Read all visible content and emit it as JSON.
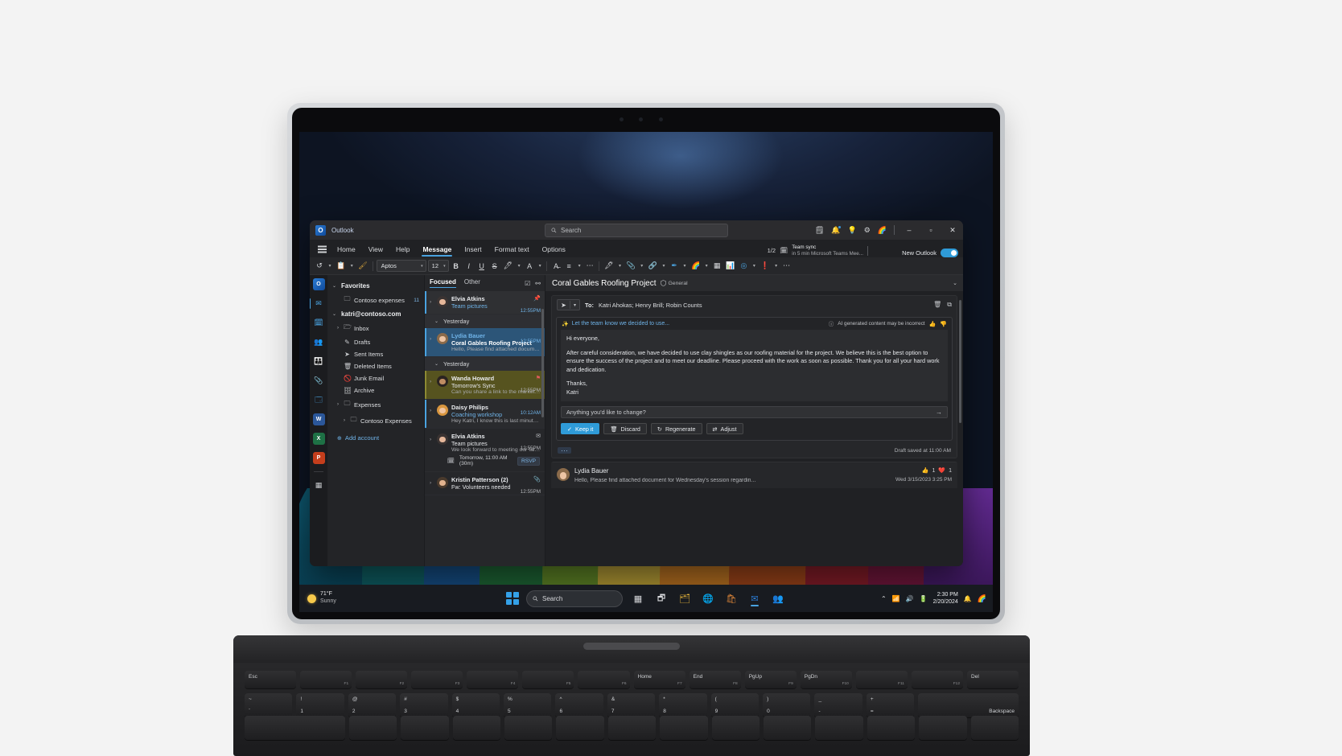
{
  "taskbar": {
    "weather_temp": "71°F",
    "weather_cond": "Sunny",
    "search_placeholder": "Search",
    "clock_time": "2:30 PM",
    "clock_date": "2/20/2024",
    "icons": [
      "start-windows-icon",
      "search-icon",
      "widgets-icon",
      "task-view-icon",
      "file-explorer-icon",
      "edge-icon",
      "store-icon",
      "outlook-icon",
      "teams-icon"
    ],
    "tray_icons": [
      "chevron-up-icon",
      "network-icon",
      "volume-icon",
      "battery-icon",
      "notification-bell-icon",
      "copilot-icon"
    ]
  },
  "outlook": {
    "app_name": "Outlook",
    "search_placeholder": "Search",
    "titlebar_icons": [
      "note-check-icon",
      "notifications-icon",
      "tips-bulb-icon",
      "settings-gear-icon",
      "copilot-icon"
    ],
    "window_controls": [
      "minimize",
      "maximize",
      "close"
    ],
    "ribbon_tabs": [
      {
        "label": "Home",
        "active": false
      },
      {
        "label": "View",
        "active": false
      },
      {
        "label": "Help",
        "active": false
      },
      {
        "label": "Message",
        "active": true
      },
      {
        "label": "Insert",
        "active": false
      },
      {
        "label": "Format text",
        "active": false
      },
      {
        "label": "Options",
        "active": false
      }
    ],
    "meeting_chip": {
      "pager": "1/2",
      "title": "Team sync",
      "subtitle": "in 5 min Microsoft Teams Mee..."
    },
    "new_outlook": {
      "label": "New Outlook",
      "enabled": true
    },
    "toolbar": {
      "font_name": "Aptos",
      "font_size": "12",
      "buttons": [
        "undo-icon",
        "paste-icon",
        "format-painter-icon",
        "bold-icon",
        "italic-icon",
        "underline-icon",
        "strikethrough-icon",
        "highlight-color-icon",
        "font-color-icon",
        "paragraph-icon",
        "more-icon",
        "dictate-icon",
        "attach-file-icon",
        "insert-link-icon",
        "signature-icon",
        "copilot-icon",
        "table-icon",
        "poll-icon",
        "loop-icon",
        "high-importance-icon",
        "overflow-icon"
      ]
    }
  },
  "app_rail": [
    {
      "name": "outlook-logo-icon",
      "selected": false
    },
    {
      "name": "mail-icon",
      "selected": true
    },
    {
      "name": "calendar-icon",
      "selected": false
    },
    {
      "name": "people-icon",
      "selected": false
    },
    {
      "name": "teams-groups-icon",
      "selected": false
    },
    {
      "name": "attachments-icon",
      "selected": false
    },
    {
      "name": "to-do-icon",
      "selected": false
    },
    {
      "name": "word-icon",
      "selected": false
    },
    {
      "name": "excel-icon",
      "selected": false
    },
    {
      "name": "powerpoint-icon",
      "selected": false
    },
    {
      "name": "apps-grid-icon",
      "selected": false
    }
  ],
  "folder_pane": {
    "favorites_label": "Favorites",
    "favorites": [
      {
        "label": "Contoso expenses",
        "count": "11",
        "icon": "folder-icon"
      }
    ],
    "account_label": "katri@contoso.com",
    "folders": [
      {
        "label": "Inbox",
        "icon": "inbox-icon",
        "expandable": true
      },
      {
        "label": "Drafts",
        "icon": "drafts-pencil-icon",
        "expandable": false
      },
      {
        "label": "Sent Items",
        "icon": "sent-icon",
        "expandable": false
      },
      {
        "label": "Deleted Items",
        "icon": "trash-icon",
        "expandable": false
      },
      {
        "label": "Junk Email",
        "icon": "junk-icon",
        "expandable": false
      },
      {
        "label": "Archive",
        "icon": "archive-icon",
        "expandable": false
      },
      {
        "label": "Expenses",
        "icon": "folder-icon",
        "expandable": true
      },
      {
        "label": "Contoso Expenses",
        "icon": "folder-icon",
        "expandable": true
      }
    ],
    "add_account_label": "Add account"
  },
  "message_list": {
    "tabs": [
      {
        "label": "Focused",
        "active": true
      },
      {
        "label": "Other",
        "active": false
      }
    ],
    "header_icons": [
      "select-all-icon",
      "filter-icon"
    ],
    "items": [
      {
        "type": "message",
        "sender": "Elvia Atkins",
        "subject": "Team pictures",
        "preview": "",
        "time": "12:55PM",
        "unread": true,
        "selected": false,
        "pinned": true,
        "accent": "#4aa3e0",
        "avatar_hair": "#3a3332",
        "avatar_skin": "#e5b79a"
      },
      {
        "type": "group",
        "label": "Yesterday"
      },
      {
        "type": "message",
        "sender": "Lydia Bauer",
        "subject": "Coral Gables Roofing Project",
        "preview": "Hello, Please find attached document for...",
        "time": "12:55PM",
        "unread": true,
        "selected": true,
        "accent": "#4aa3e0",
        "avatar_hair": "#8a6a4a",
        "avatar_skin": "#edc4a4"
      },
      {
        "type": "group",
        "label": "Yesterday"
      },
      {
        "type": "message",
        "sender": "Wanda Howard",
        "subject": "Tomorrow's Sync",
        "preview": "Can you share a link to the marketing asse...",
        "time": "12:55PM",
        "unread": false,
        "flagged": true,
        "accent": "#6b6a26",
        "avatar_hair": "#2a2321",
        "avatar_skin": "#c08d63"
      },
      {
        "type": "message",
        "sender": "Daisy Philips",
        "subject": "Coaching workshop",
        "preview": "Hey Katri, I know this is last minute, but d...",
        "time": "10:12AM",
        "unread": true,
        "accent": "#4aa3e0",
        "avatar_hair": "#d8963f",
        "avatar_skin": "#f0c49f"
      },
      {
        "type": "message",
        "sender": "Elvia Atkins",
        "subject": "Team pictures",
        "preview": "We look forward to meeting our fall intern...",
        "time": "12:55PM",
        "unread": false,
        "has_calendar": true,
        "calendar_text": "Tomorrow, 11:00 AM (30m)",
        "rsvp_label": "RSVP",
        "envelope_icon": "envelope-icon",
        "avatar_hair": "#3a3332",
        "avatar_skin": "#e5b79a"
      },
      {
        "type": "message",
        "sender": "Kristin Patterson (2)",
        "subject": "Fw: Volunteers needed",
        "preview": "",
        "time": "12:55PM",
        "unread": false,
        "attachment": true,
        "avatar_hair": "#4a3a2c",
        "avatar_skin": "#e2b38f"
      }
    ]
  },
  "reading_pane": {
    "title": "Coral Gables Roofing Project",
    "sensitivity": "General",
    "sensitivity_icon": "shield-icon",
    "compose": {
      "send_label": "Send",
      "to_label": "To:",
      "recipients": "Katri Ahokas; Henry Brill; Robin Counts",
      "action_icons": [
        "delete-icon",
        "copy-icon"
      ],
      "ai": {
        "prompt_text": "Let the team know we decided to use...",
        "prompt_icon": "copilot-draft-icon",
        "disclaimer": "AI generated content may be incorrect",
        "feedback_icons": [
          "thumbs-up-icon",
          "thumbs-down-icon"
        ],
        "body_paragraphs": [
          "Hi everyone,",
          "After careful consideration, we have decided to use clay shingles as our roofing material for the project. We believe this is the best option to ensure the success of the project and to meet our deadline. Please proceed with the work as soon as possible.  Thank you for all your hard work and dedication.",
          "Thanks,\nKatri"
        ],
        "input_placeholder": "Anything you'd like to change?",
        "buttons": [
          {
            "label": "Keep it",
            "icon": "check-icon",
            "primary": true
          },
          {
            "label": "Discard",
            "icon": "trash-icon",
            "primary": false
          },
          {
            "label": "Regenerate",
            "icon": "refresh-icon",
            "primary": false
          },
          {
            "label": "Adjust",
            "icon": "sliders-icon",
            "primary": false
          }
        ]
      },
      "draft_status": "Draft saved at 11:00 AM"
    },
    "conversation": {
      "sender": "Lydia Bauer",
      "preview": "Hello, Please find attached document for Wednesday's session regardin...",
      "timestamp": "Wed 3/15/2023 3:25 PM",
      "reactions": [
        {
          "icon": "thumbs-up-emoji",
          "count": "1"
        },
        {
          "icon": "heart-emoji",
          "count": "1"
        }
      ],
      "avatar_hair": "#8a6a4a",
      "avatar_skin": "#edc4a4"
    }
  },
  "keyboard": {
    "fn_row": [
      "Esc",
      "F1",
      "F2",
      "F3",
      "F4",
      "F5",
      "F6",
      "F7",
      "F8",
      "F9",
      "F10",
      "F11",
      "F12",
      "Del"
    ],
    "fn_labels": [
      "",
      "",
      "",
      "",
      "",
      "",
      "",
      "Home",
      "End",
      "PgUp",
      "PgDn",
      ""
    ],
    "number_row": [
      {
        "top": "~",
        "bottom": "`"
      },
      {
        "top": "!",
        "bottom": "1"
      },
      {
        "top": "@",
        "bottom": "2"
      },
      {
        "top": "#",
        "bottom": "3"
      },
      {
        "top": "$",
        "bottom": "4"
      },
      {
        "top": "%",
        "bottom": "5"
      },
      {
        "top": "^",
        "bottom": "6"
      },
      {
        "top": "&",
        "bottom": "7"
      },
      {
        "top": "*",
        "bottom": "8"
      },
      {
        "top": "(",
        "bottom": "9"
      },
      {
        "top": ")",
        "bottom": "0"
      },
      {
        "top": "_",
        "bottom": "-"
      },
      {
        "top": "+",
        "bottom": "="
      }
    ],
    "backspace_label": "Backspace"
  }
}
